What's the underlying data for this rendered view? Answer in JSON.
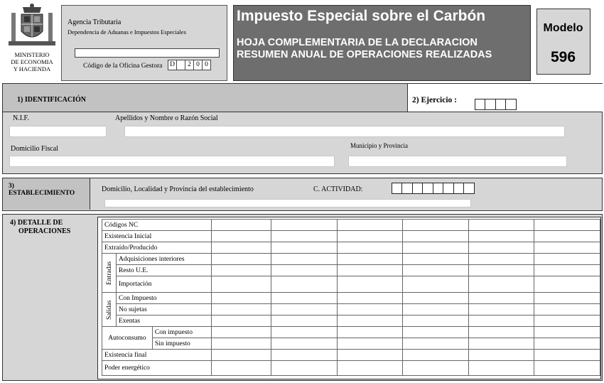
{
  "header": {
    "ministry": [
      "MINISTERIO",
      "DE ECONOMIA",
      "Y HACIENDA"
    ],
    "agency_title": "Agencia Tributaria",
    "agency_subtitle": "Dependencia de Aduanas e Impuestos Especiales",
    "office_label": "Código de la Oficina Gestora",
    "office_code": [
      "D",
      "",
      "2",
      "0",
      "0"
    ],
    "form_title": "Impuesto Especial  sobre el Carbón",
    "form_subtitle_1": "HOJA COMPLEMENTARIA DE LA DECLARACION",
    "form_subtitle_2": "RESUMEN ANUAL  DE OPERACIONES REALIZADAS",
    "modelo_label": "Modelo",
    "modelo_number": "596"
  },
  "identification": {
    "section_label": "1) IDENTIFICACIÓN",
    "nif_label": "N.I.F.",
    "name_label": "Apellidos y Nombre o Razón Social",
    "address_label": "Domicilio Fiscal",
    "municipality_label": "Municipio y Provincia",
    "nif_value": "",
    "name_value": "",
    "address_value": "",
    "municipality_value": ""
  },
  "ejercicio": {
    "label": "2)   Ejercicio :",
    "digits": [
      "",
      "",
      "",
      ""
    ]
  },
  "establishment": {
    "number": "3)",
    "label": "ESTABLECIMIENTO",
    "address_label": "Domicilio, Localidad y Provincia del establecimiento",
    "activity_label": "C. ACTIVIDAD:",
    "activity_digits": [
      "",
      "",
      "",
      "",
      "",
      "",
      "",
      ""
    ],
    "address_value": ""
  },
  "operations": {
    "label_line1": "4) DETALLE     DE",
    "label_line2": "OPERACIONES",
    "rows": {
      "codigos": "Códigos NC",
      "existencia_inicial": "Existencia Inicial",
      "extraido": "Extraído/Producido",
      "entradas": "Entradas",
      "adquisiciones": "Adquisiciones interiores",
      "resto_ue": "Resto U.E.",
      "importacion": "Importación",
      "salidas": "Salidas",
      "con_impuesto": "Con Impuesto",
      "no_sujetas": "No sujetas",
      "exentas": "Exentas",
      "autoconsumo": "Autoconsumo",
      "auto_con": "Con impuesto",
      "auto_sin": "Sin impuesto",
      "existencia_final": "Existencia final",
      "poder": "Poder energético"
    }
  }
}
